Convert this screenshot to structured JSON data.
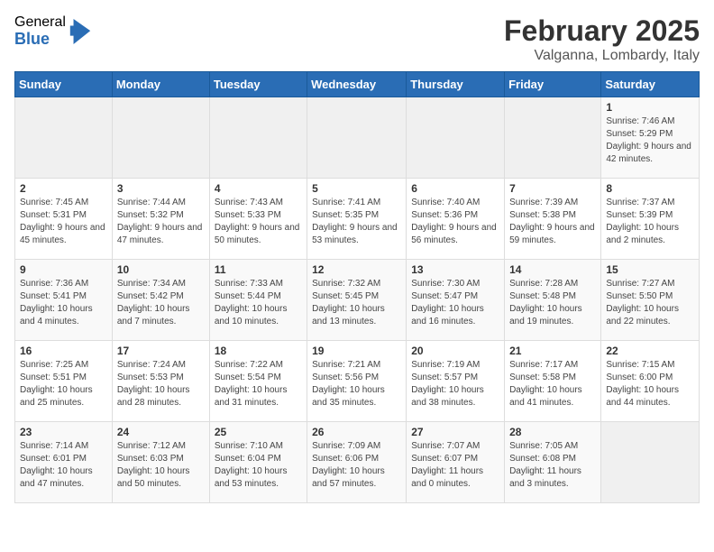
{
  "logo": {
    "general": "General",
    "blue": "Blue"
  },
  "title": "February 2025",
  "location": "Valganna, Lombardy, Italy",
  "weekdays": [
    "Sunday",
    "Monday",
    "Tuesday",
    "Wednesday",
    "Thursday",
    "Friday",
    "Saturday"
  ],
  "weeks": [
    [
      {
        "day": "",
        "info": ""
      },
      {
        "day": "",
        "info": ""
      },
      {
        "day": "",
        "info": ""
      },
      {
        "day": "",
        "info": ""
      },
      {
        "day": "",
        "info": ""
      },
      {
        "day": "",
        "info": ""
      },
      {
        "day": "1",
        "info": "Sunrise: 7:46 AM\nSunset: 5:29 PM\nDaylight: 9 hours and 42 minutes."
      }
    ],
    [
      {
        "day": "2",
        "info": "Sunrise: 7:45 AM\nSunset: 5:31 PM\nDaylight: 9 hours and 45 minutes."
      },
      {
        "day": "3",
        "info": "Sunrise: 7:44 AM\nSunset: 5:32 PM\nDaylight: 9 hours and 47 minutes."
      },
      {
        "day": "4",
        "info": "Sunrise: 7:43 AM\nSunset: 5:33 PM\nDaylight: 9 hours and 50 minutes."
      },
      {
        "day": "5",
        "info": "Sunrise: 7:41 AM\nSunset: 5:35 PM\nDaylight: 9 hours and 53 minutes."
      },
      {
        "day": "6",
        "info": "Sunrise: 7:40 AM\nSunset: 5:36 PM\nDaylight: 9 hours and 56 minutes."
      },
      {
        "day": "7",
        "info": "Sunrise: 7:39 AM\nSunset: 5:38 PM\nDaylight: 9 hours and 59 minutes."
      },
      {
        "day": "8",
        "info": "Sunrise: 7:37 AM\nSunset: 5:39 PM\nDaylight: 10 hours and 2 minutes."
      }
    ],
    [
      {
        "day": "9",
        "info": "Sunrise: 7:36 AM\nSunset: 5:41 PM\nDaylight: 10 hours and 4 minutes."
      },
      {
        "day": "10",
        "info": "Sunrise: 7:34 AM\nSunset: 5:42 PM\nDaylight: 10 hours and 7 minutes."
      },
      {
        "day": "11",
        "info": "Sunrise: 7:33 AM\nSunset: 5:44 PM\nDaylight: 10 hours and 10 minutes."
      },
      {
        "day": "12",
        "info": "Sunrise: 7:32 AM\nSunset: 5:45 PM\nDaylight: 10 hours and 13 minutes."
      },
      {
        "day": "13",
        "info": "Sunrise: 7:30 AM\nSunset: 5:47 PM\nDaylight: 10 hours and 16 minutes."
      },
      {
        "day": "14",
        "info": "Sunrise: 7:28 AM\nSunset: 5:48 PM\nDaylight: 10 hours and 19 minutes."
      },
      {
        "day": "15",
        "info": "Sunrise: 7:27 AM\nSunset: 5:50 PM\nDaylight: 10 hours and 22 minutes."
      }
    ],
    [
      {
        "day": "16",
        "info": "Sunrise: 7:25 AM\nSunset: 5:51 PM\nDaylight: 10 hours and 25 minutes."
      },
      {
        "day": "17",
        "info": "Sunrise: 7:24 AM\nSunset: 5:53 PM\nDaylight: 10 hours and 28 minutes."
      },
      {
        "day": "18",
        "info": "Sunrise: 7:22 AM\nSunset: 5:54 PM\nDaylight: 10 hours and 31 minutes."
      },
      {
        "day": "19",
        "info": "Sunrise: 7:21 AM\nSunset: 5:56 PM\nDaylight: 10 hours and 35 minutes."
      },
      {
        "day": "20",
        "info": "Sunrise: 7:19 AM\nSunset: 5:57 PM\nDaylight: 10 hours and 38 minutes."
      },
      {
        "day": "21",
        "info": "Sunrise: 7:17 AM\nSunset: 5:58 PM\nDaylight: 10 hours and 41 minutes."
      },
      {
        "day": "22",
        "info": "Sunrise: 7:15 AM\nSunset: 6:00 PM\nDaylight: 10 hours and 44 minutes."
      }
    ],
    [
      {
        "day": "23",
        "info": "Sunrise: 7:14 AM\nSunset: 6:01 PM\nDaylight: 10 hours and 47 minutes."
      },
      {
        "day": "24",
        "info": "Sunrise: 7:12 AM\nSunset: 6:03 PM\nDaylight: 10 hours and 50 minutes."
      },
      {
        "day": "25",
        "info": "Sunrise: 7:10 AM\nSunset: 6:04 PM\nDaylight: 10 hours and 53 minutes."
      },
      {
        "day": "26",
        "info": "Sunrise: 7:09 AM\nSunset: 6:06 PM\nDaylight: 10 hours and 57 minutes."
      },
      {
        "day": "27",
        "info": "Sunrise: 7:07 AM\nSunset: 6:07 PM\nDaylight: 11 hours and 0 minutes."
      },
      {
        "day": "28",
        "info": "Sunrise: 7:05 AM\nSunset: 6:08 PM\nDaylight: 11 hours and 3 minutes."
      },
      {
        "day": "",
        "info": ""
      }
    ]
  ]
}
